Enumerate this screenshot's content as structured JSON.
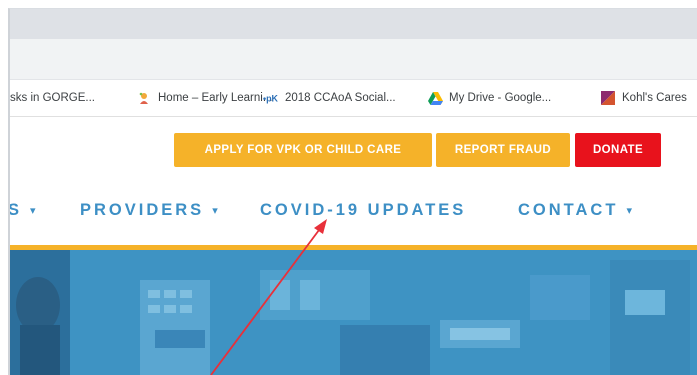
{
  "bookmarks": [
    {
      "label": "sks in GORGE...",
      "icon": "page-icon"
    },
    {
      "label": "Home – Early Learni...",
      "icon": "child-icon"
    },
    {
      "label": "2018 CCAoA Social...",
      "icon": "vpk-icon"
    },
    {
      "label": "My Drive - Google...",
      "icon": "google-drive-icon"
    },
    {
      "label": "Kohl's Cares",
      "icon": "kohls-icon"
    }
  ],
  "header": {
    "apply_label": "APPLY FOR VPK OR CHILD CARE",
    "fraud_label": "REPORT FRAUD",
    "donate_label": "DONATE"
  },
  "nav": {
    "items": [
      {
        "label": "S",
        "caret": "▾"
      },
      {
        "label": "PROVIDERS",
        "caret": "▾"
      },
      {
        "label": "COVID-19 UPDATES",
        "caret": ""
      },
      {
        "label": "CONTACT",
        "caret": "▾"
      }
    ]
  },
  "colors": {
    "accent_gold": "#f5b229",
    "nav_blue": "#3d8fc5",
    "donate_red": "#e8121c",
    "arrow_red": "#e8303a",
    "hero_blue": "#3f95c4"
  }
}
